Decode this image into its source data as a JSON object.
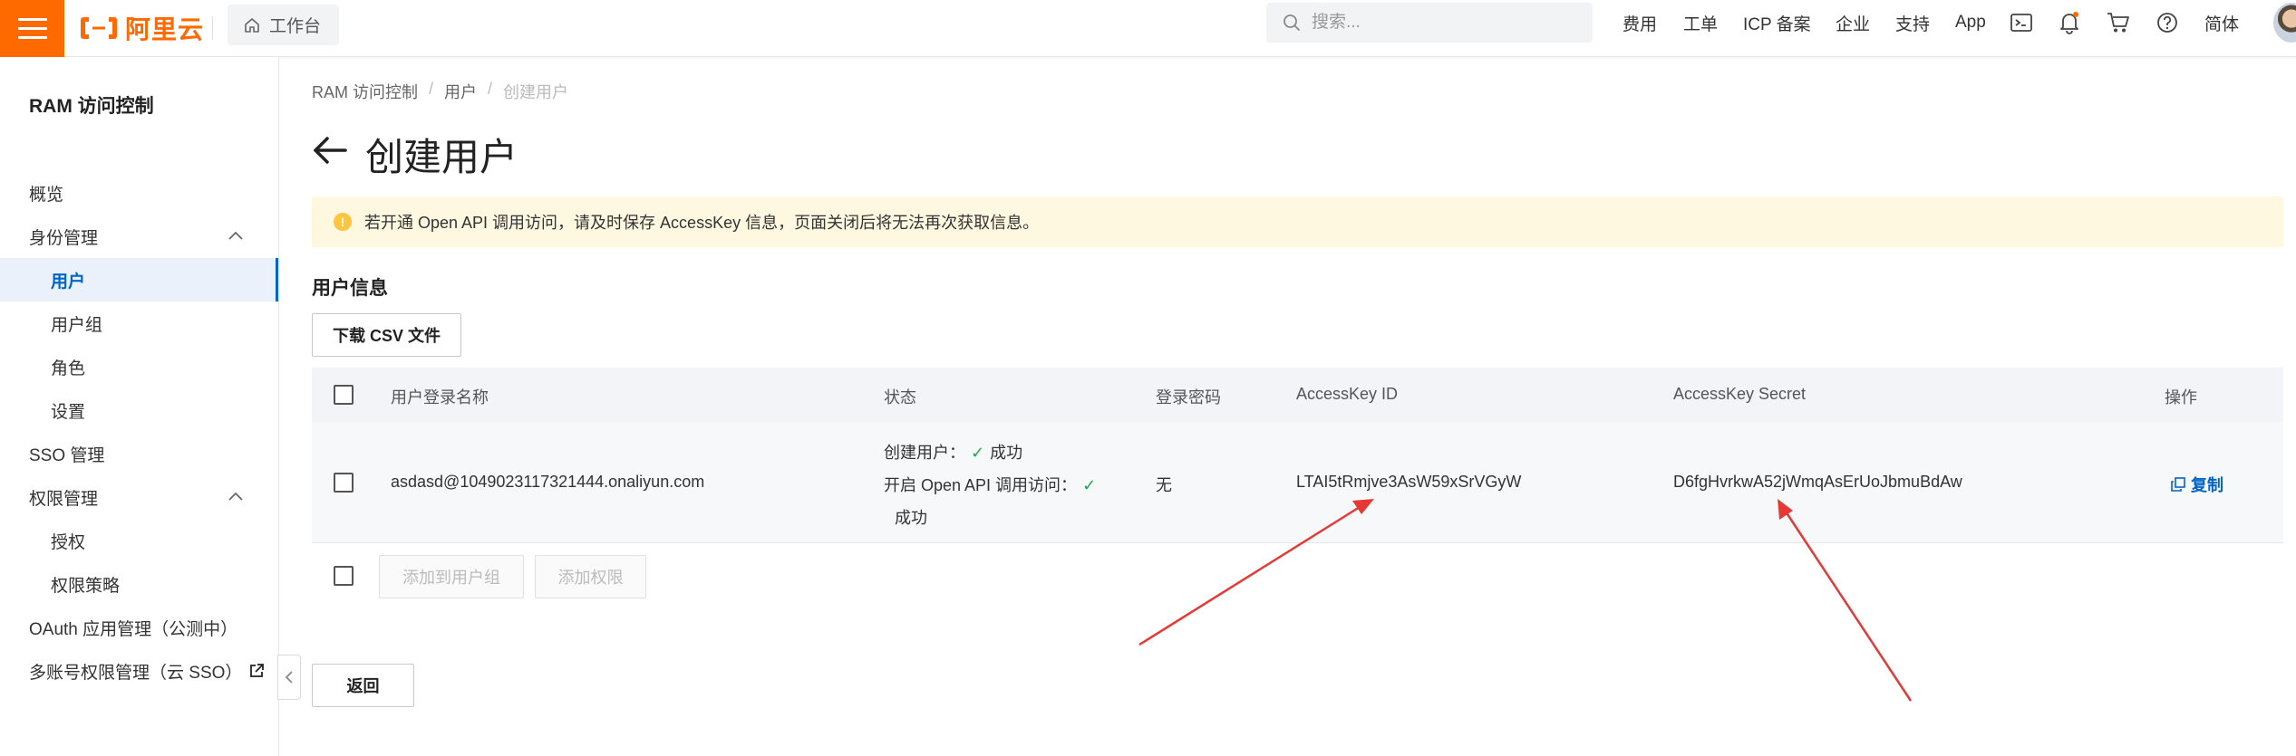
{
  "topbar": {
    "logo_text": "阿里云",
    "workbench_label": "工作台",
    "search_placeholder": "搜索...",
    "nav": [
      "费用",
      "工单",
      "ICP 备案",
      "企业",
      "支持",
      "App"
    ],
    "language": "简体",
    "icons": [
      "terminal-icon",
      "bell-icon",
      "cart-icon",
      "help-icon"
    ],
    "accent_color": "#ff6a00"
  },
  "sidebar": {
    "title": "RAM 访问控制",
    "items": [
      {
        "label": "概览",
        "level": 1
      },
      {
        "label": "身份管理",
        "level": 1,
        "expanded": true
      },
      {
        "label": "用户",
        "level": 2,
        "active": true
      },
      {
        "label": "用户组",
        "level": 2
      },
      {
        "label": "角色",
        "level": 2
      },
      {
        "label": "设置",
        "level": 2
      },
      {
        "label": "SSO 管理",
        "level": 1
      },
      {
        "label": "权限管理",
        "level": 1,
        "expanded": true
      },
      {
        "label": "授权",
        "level": 2
      },
      {
        "label": "权限策略",
        "level": 2
      },
      {
        "label": "OAuth 应用管理（公测中）",
        "level": 1
      },
      {
        "label": "多账号权限管理（云 SSO）",
        "level": 1,
        "external": true
      }
    ]
  },
  "breadcrumb": [
    "RAM 访问控制",
    "用户",
    "创建用户"
  ],
  "page_title": "创建用户",
  "alert_text": "若开通 Open API 调用访问，请及时保存 AccessKey 信息，页面关闭后将无法再次获取信息。",
  "section_title": "用户信息",
  "download_button": "下载 CSV 文件",
  "table": {
    "headers": [
      "用户登录名称",
      "状态",
      "登录密码",
      "AccessKey ID",
      "AccessKey Secret",
      "操作"
    ],
    "row": {
      "login_name": "asdasd@1049023117321444.onaliyun.com",
      "status_create_label": "创建用户：",
      "status_create_value": "成功",
      "status_api_label": "开启 Open API 调用访问：",
      "status_api_value": "成功",
      "password": "无",
      "access_key_id": "LTAI5tRmjve3AsW59xSrVGyW",
      "access_key_secret": "D6fgHvrkwA52jWmqAsErUoJbmuBdAw",
      "action": "复制"
    }
  },
  "batch_buttons": [
    "添加到用户组",
    "添加权限"
  ],
  "back_button": "返回",
  "annotation_color": "#e53935"
}
